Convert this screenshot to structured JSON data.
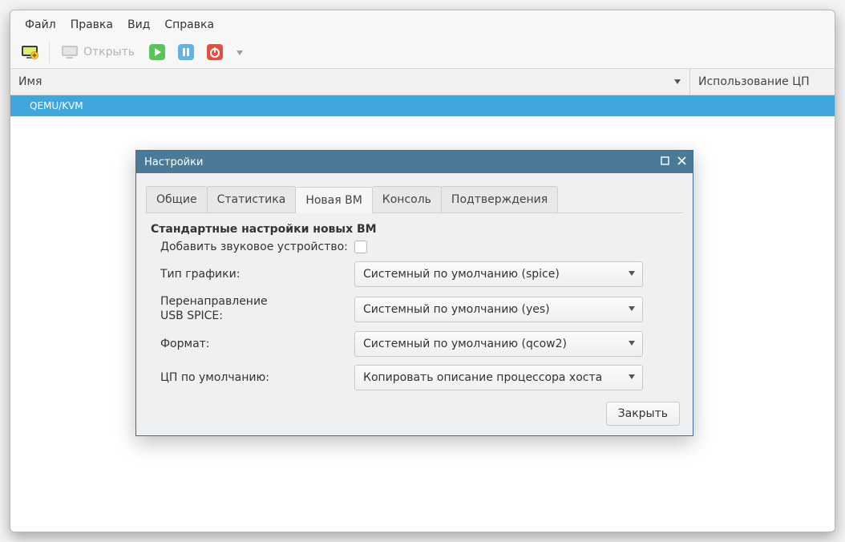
{
  "menubar": [
    "Файл",
    "Правка",
    "Вид",
    "Справка"
  ],
  "toolbar": {
    "open_label": "Открыть"
  },
  "columns": {
    "name": "Имя",
    "cpu": "Использование ЦП"
  },
  "connection": "QEMU/KVM",
  "dialog": {
    "title": "Настройки",
    "tabs": [
      "Общие",
      "Статистика",
      "Новая ВМ",
      "Консоль",
      "Подтверждения"
    ],
    "active_tab": 2,
    "section_title": "Стандартные настройки новых ВМ",
    "add_sound_label": "Добавить звуковое устройство:",
    "add_sound_checked": false,
    "graphics_label": "Тип графики:",
    "graphics_value": "Системный по умолчанию (spice)",
    "usb_label_line1": "Перенаправление",
    "usb_label_line2": "USB SPICE:",
    "usb_value": "Системный по умолчанию (yes)",
    "format_label": "Формат:",
    "format_value": "Системный по умолчанию (qcow2)",
    "cpu_label": "ЦП по умолчанию:",
    "cpu_value": "Копировать описание процессора хоста",
    "close_label": "Закрыть"
  }
}
